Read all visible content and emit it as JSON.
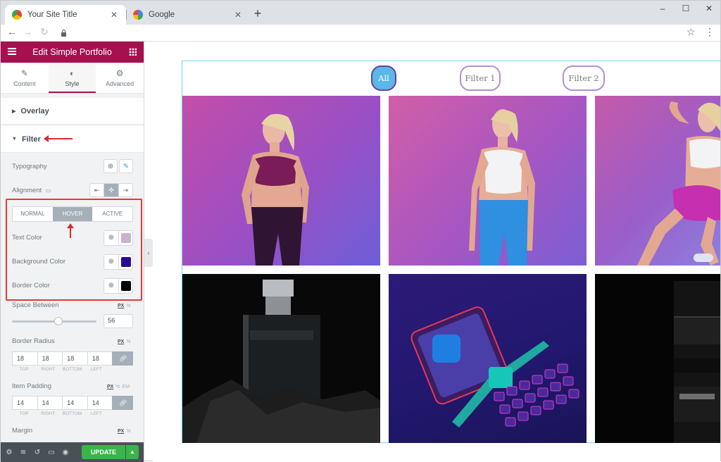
{
  "browser": {
    "tabs": [
      {
        "title": "Your Site Title",
        "active": true
      },
      {
        "title": "Google",
        "active": false
      }
    ],
    "new_tab_symbol": "+",
    "window_controls": [
      "–",
      "☐",
      "✕"
    ],
    "colors": {
      "tabbar": "#dee1e6"
    }
  },
  "panel": {
    "title": "Edit Simple Portfolio",
    "accent_color": "#a4114e",
    "tabs": [
      {
        "label": "Content",
        "icon": "pencil-icon"
      },
      {
        "label": "Style",
        "icon": "half-circle-icon",
        "active": true
      },
      {
        "label": "Advanced",
        "icon": "gear-icon"
      }
    ],
    "sections": {
      "overlay": "Overlay",
      "filter": "Filter"
    },
    "controls": {
      "typography": "Typography",
      "alignment": "Alignment",
      "state_tabs": [
        "NORMAL",
        "HOVER",
        "ACTIVE"
      ],
      "active_state": "HOVER",
      "text_color_label": "Text Color",
      "text_color": "#c9b3cf",
      "bg_color_label": "Background Color",
      "bg_color": "#2a0a8e",
      "border_color_label": "Border Color",
      "border_color": "#000000",
      "space_between_label": "Space Between",
      "space_between_value": "56",
      "space_between_fraction": 0.55,
      "border_radius_label": "Border Radius",
      "border_radius_values": [
        "18",
        "18",
        "18",
        "18"
      ],
      "item_padding_label": "Item Padding",
      "item_padding_values": [
        "14",
        "14",
        "14",
        "14"
      ],
      "dim_labels": [
        "TOP",
        "RIGHT",
        "BOTTOM",
        "LEFT"
      ],
      "margin_label": "Margin",
      "unit_px": "PX",
      "unit_pct": "%",
      "unit_em": "EM"
    },
    "footer": {
      "update_label": "UPDATE"
    }
  },
  "preview": {
    "filters": [
      "All",
      "Filter 1",
      "Filter 2"
    ],
    "active_filter": "All",
    "gallery": [
      "woman-pink-sports-bra",
      "woman-white-top-blue-leggings",
      "woman-lunge-pink-shorts",
      "prada-perfume-bottle",
      "smartwatch-phone-keyboard",
      "camera-lens"
    ]
  }
}
